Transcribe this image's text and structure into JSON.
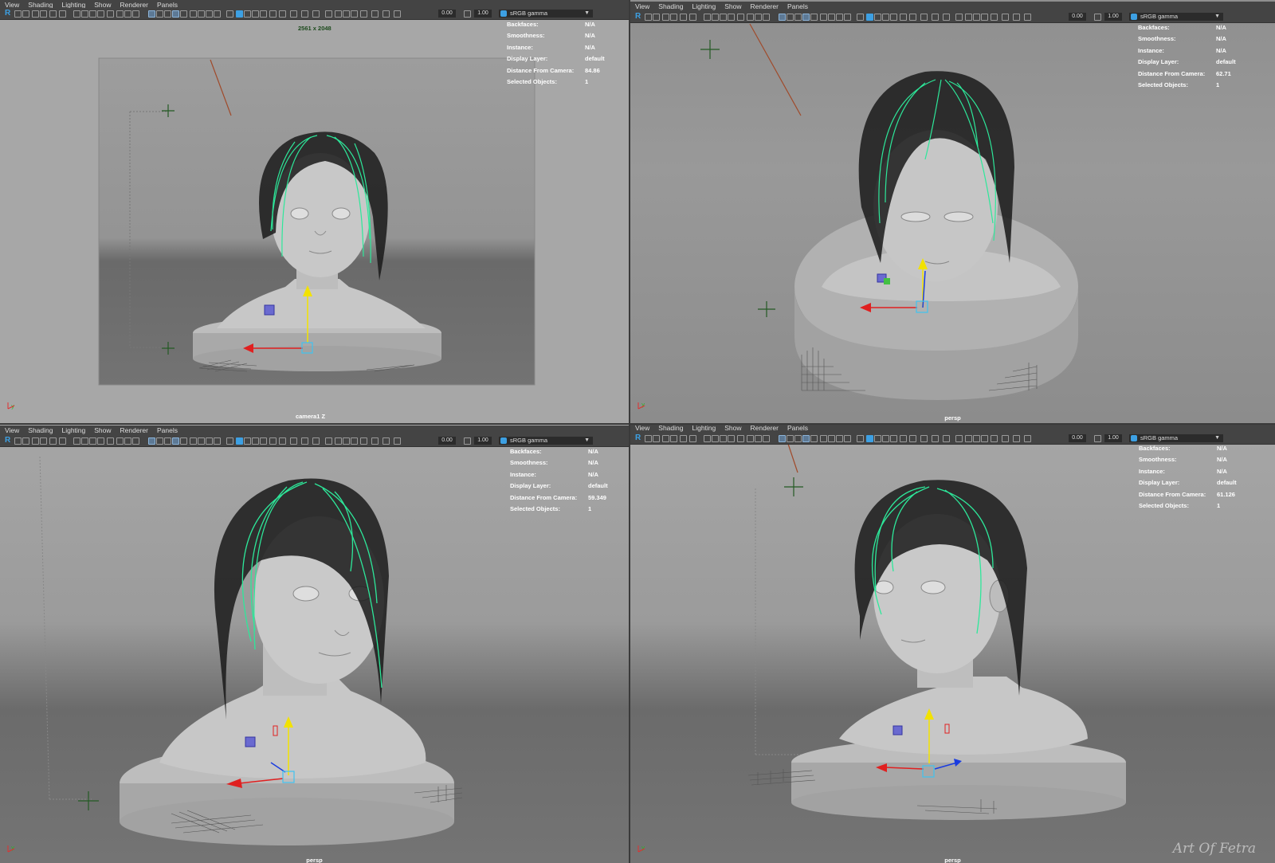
{
  "menu": [
    "View",
    "Shading",
    "Lighting",
    "Show",
    "Renderer",
    "Panels"
  ],
  "toolbar": {
    "value_a": "0.00",
    "value_b": "1.00",
    "color_space": "sRGB gamma",
    "logo": "R"
  },
  "hud_keys": [
    "Backfaces:",
    "Smoothness:",
    "Instance:",
    "Display Layer:",
    "Distance From Camera:",
    "Selected Objects:"
  ],
  "viewports": [
    {
      "camera": "camera1 Z",
      "resolution_gate": "2561 x 2048",
      "hud_values": [
        "N/A",
        "N/A",
        "N/A",
        "default",
        "84.86",
        "1"
      ]
    },
    {
      "camera": "persp",
      "hud_values": [
        "N/A",
        "N/A",
        "N/A",
        "default",
        "62.71",
        "1"
      ]
    },
    {
      "camera": "persp",
      "hud_values": [
        "N/A",
        "N/A",
        "N/A",
        "default",
        "59.349",
        "1"
      ]
    },
    {
      "camera": "persp",
      "hud_values": [
        "N/A",
        "N/A",
        "N/A",
        "default",
        "61.126",
        "1"
      ]
    }
  ],
  "watermark": "Art Of Fetra",
  "colors": {
    "guide_curve": "#2de89a",
    "hair": "#111111",
    "x_axis": "#e02020",
    "y_axis": "#f2e200",
    "z_axis": "#1a3ce0",
    "selection": "#3fc3f0"
  }
}
